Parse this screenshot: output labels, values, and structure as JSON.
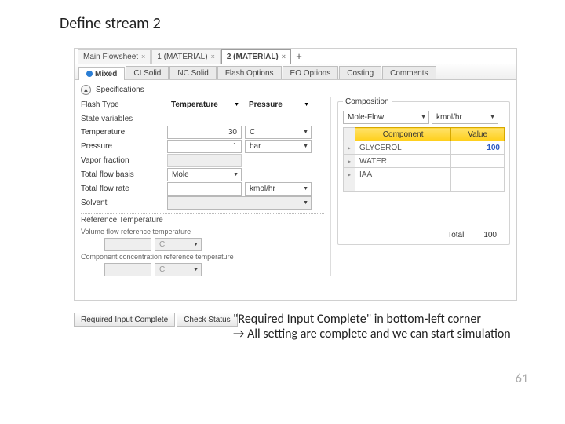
{
  "heading": "Define stream 2",
  "doc_tabs": [
    {
      "label": "Main Flowsheet"
    },
    {
      "label": "1 (MATERIAL)"
    },
    {
      "label": "2 (MATERIAL)"
    }
  ],
  "plus": "+",
  "subtabs": [
    {
      "label": "Mixed"
    },
    {
      "label": "CI Solid"
    },
    {
      "label": "NC Solid"
    },
    {
      "label": "Flash Options"
    },
    {
      "label": "EO Options"
    },
    {
      "label": "Costing"
    },
    {
      "label": "Comments"
    }
  ],
  "spec_title": "Specifications",
  "labels": {
    "flash_type": "Flash Type",
    "state_vars": "State variables",
    "temperature": "Temperature",
    "pressure": "Pressure",
    "vapor_fraction": "Vapor fraction",
    "total_flow_basis": "Total flow basis",
    "total_flow_rate": "Total flow rate",
    "solvent": "Solvent",
    "reference_temp": "Reference Temperature",
    "vol_flow_ref": "Volume flow reference temperature",
    "comp_conc_ref": "Component concentration reference temperature"
  },
  "values": {
    "flash_type_1": "Temperature",
    "flash_type_2": "Pressure",
    "temperature": "30",
    "temperature_unit": "C",
    "pressure": "1",
    "pressure_unit": "bar",
    "total_flow_basis": "Mole",
    "total_flow_rate_unit": "kmol/hr",
    "ref_unit": "C"
  },
  "composition": {
    "legend": "Composition",
    "basis": "Mole-Flow",
    "unit": "kmol/hr",
    "columns": [
      "Component",
      "Value"
    ],
    "rows": [
      {
        "component": "GLYCEROL",
        "value": "100"
      },
      {
        "component": "WATER",
        "value": ""
      },
      {
        "component": "IAA",
        "value": ""
      }
    ],
    "total_label": "Total",
    "total_value": "100"
  },
  "status": {
    "complete": "Required Input Complete",
    "check": "Check Status"
  },
  "caption_line1": "\"Required Input Complete\" in bottom-left corner",
  "caption_line2": "→ All setting are complete and we can start simulation",
  "page_number": "61"
}
